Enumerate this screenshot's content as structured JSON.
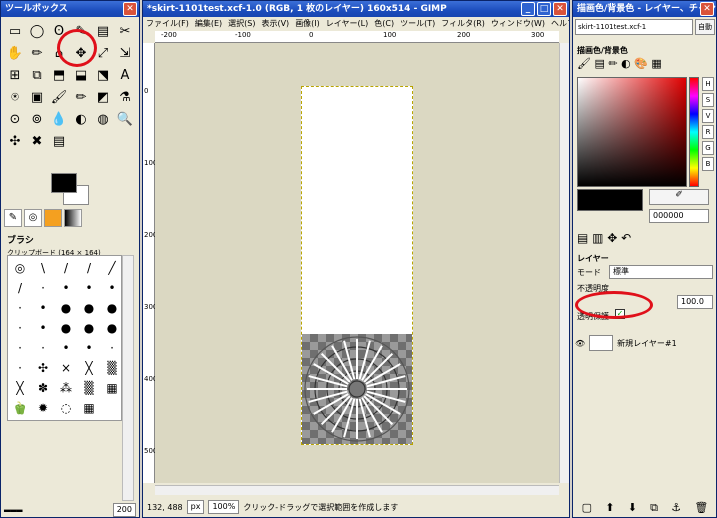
{
  "toolbox": {
    "title": "ツールボックス",
    "tools": [
      "▭",
      "◯",
      "ʘ",
      "✎",
      "▤",
      "✂",
      "✋",
      "✏",
      "⌂",
      "✥",
      "⤢",
      "⇲",
      "⊞",
      "⧉",
      "⬒",
      "⬓",
      "⬔",
      "A",
      "⍟",
      "▣",
      "🖌",
      "✏",
      "◩",
      "⚗",
      "⊙",
      "⊚",
      "💧",
      "◐",
      "◍",
      "🔍",
      "✣",
      "✖",
      "▤"
    ],
    "brush_title": "ブラシ",
    "brush_sub": "クリップボード (164 × 164)",
    "brushes": [
      "◎",
      "\\",
      "/",
      "/",
      "╱",
      "/",
      "·",
      "•",
      "•",
      "•",
      "·",
      "•",
      "●",
      "●",
      "●",
      "·",
      "•",
      "●",
      "●",
      "●",
      "·",
      "·",
      "•",
      "•",
      "·",
      "·",
      "✣",
      "×",
      "╳",
      "▒",
      "╳",
      "✽",
      "⁂",
      "▒",
      "▦",
      "🫑",
      "✹",
      "◌",
      "▦"
    ],
    "spacing": "200"
  },
  "image_window": {
    "title": "*skirt-1101test.xcf-1.0 (RGB, 1 枚のレイヤー) 160x514 - GIMP",
    "menu": [
      "ファイル(F)",
      "編集(E)",
      "選択(S)",
      "表示(V)",
      "画像(I)",
      "レイヤー(L)",
      "色(C)",
      "ツール(T)",
      "フィルタ(R)",
      "ウィンドウ(W)",
      "ヘルプ"
    ],
    "ruler_top": [
      "-200",
      "-100",
      "0",
      "100",
      "200",
      "300"
    ],
    "ruler_left": [
      "0",
      "100",
      "200",
      "300",
      "400",
      "500"
    ],
    "coords": "132, 488",
    "unit": "px",
    "zoom": "100%",
    "status": "クリック-ドラッグで選択範囲を作成します"
  },
  "dock": {
    "title": "描画色/背景色 - レイヤー、チャンネ…",
    "image_select": "skirt-1101test.xcf-1",
    "auto_label": "自動",
    "color_title": "描画色/背景色",
    "hex_value": "000000",
    "layer_title": "レイヤー",
    "mode_label": "モード",
    "mode_value": "標準",
    "opacity_label": "不透明度",
    "opacity_value": "100.0",
    "lock_label": "透明保護",
    "layer_name": "新規レイヤー#1"
  }
}
